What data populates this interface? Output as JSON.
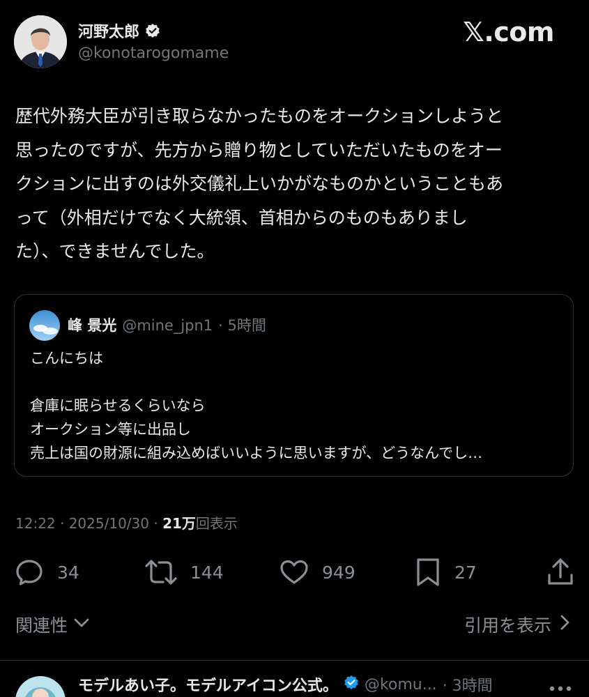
{
  "author": {
    "display_name": "河野太郎",
    "handle": "@konotarogomame",
    "verified_icon": "verified-badge-icon"
  },
  "brand": {
    "label": "𝕏.com"
  },
  "post": {
    "text": "歴代外務大臣が引き取らなかったものをオークションしようと\n思ったのですが、先方から贈り物としていただいたものをオー\nクションに出すのは外交儀礼上いかがなものかということもあ\nって（外相だけでなく大統領、首相からのものもありまし\nた）、できませんでした。"
  },
  "quote": {
    "name": "峰 景光",
    "handle": "@mine_jpn1",
    "time": "· 5時間",
    "lines": [
      "こんにちは",
      "",
      "倉庫に眠らせるくらいなら",
      "オークション等に出品し",
      "売上は国の財源に組み込めばいいように思いますが、どうなんでし…"
    ]
  },
  "meta": {
    "timestamp": "12:22 · 2025/10/30 · ",
    "views_count": "21万",
    "views_label": "回表示"
  },
  "actions": {
    "replies": "34",
    "reposts": "144",
    "likes": "949",
    "bookmarks": "27"
  },
  "footer": {
    "related_label": "関連性",
    "show_quotes_label": "引用を表示"
  },
  "next_post": {
    "name": "モデルあい子。モデルアイコン公式。",
    "handle": "@komu...",
    "time": "· 3時間"
  },
  "colors": {
    "background": "#000000",
    "text": "#e7e9ea",
    "secondary": "#71767b",
    "verified": "#1d9bf0",
    "border": "#2f3336"
  }
}
